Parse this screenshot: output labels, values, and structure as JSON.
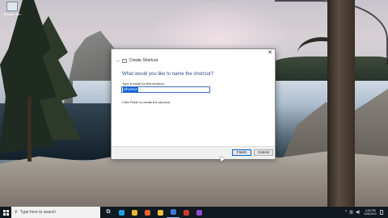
{
  "desktop": {
    "icon_label": "Recycle Bin"
  },
  "dialog": {
    "close_symbol": "✕",
    "back_symbol": "←",
    "wizard_title": "Create Shortcut",
    "question": "What would you like to name the shortcut?",
    "field_label": "Type a name for this shortcut:",
    "field_value": "Shortcut",
    "hint": "Click Finish to create the shortcut.",
    "finish_label": "Finish",
    "cancel_label": "Cancel"
  },
  "taskbar": {
    "search_placeholder": "Type here to search",
    "icons": [
      {
        "name": "task-view-icon",
        "glyph": "⧉",
        "color": "#ffffff"
      },
      {
        "name": "edge-icon",
        "glyph": "",
        "color": "#1fa0e0"
      },
      {
        "name": "chrome-icon",
        "glyph": "",
        "color": "#e9b82a"
      },
      {
        "name": "firefox-icon",
        "glyph": "",
        "color": "#e8632b"
      },
      {
        "name": "file-explorer-icon",
        "glyph": "",
        "color": "#f0c23a"
      },
      {
        "name": "store-icon",
        "glyph": "",
        "color": "#3a7bd5"
      },
      {
        "name": "mail-icon",
        "glyph": "",
        "color": "#d03a2a"
      },
      {
        "name": "app-icon",
        "glyph": "",
        "color": "#8a4bd0"
      }
    ],
    "clock_time": "4:18 PM",
    "clock_date": "3/25/2021"
  }
}
